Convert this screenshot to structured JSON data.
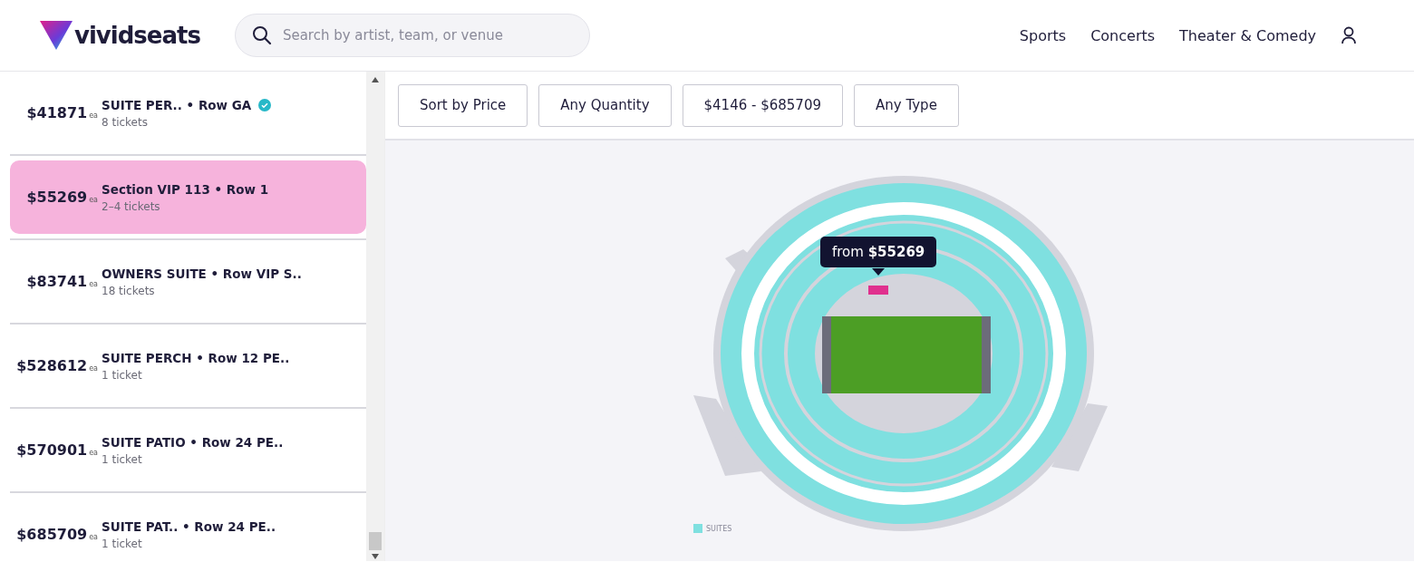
{
  "header": {
    "logo": "vividseats",
    "search": {
      "placeholder": "Search by artist, team, or venue"
    },
    "nav": [
      "Sports",
      "Concerts",
      "Theater & Comedy"
    ]
  },
  "listings": [
    {
      "price": "$41871",
      "unit": "ea",
      "title": "SUITE PER.. • Row GA",
      "tickets": "8 tickets",
      "verified": true,
      "selected": false
    },
    {
      "price": "$55269",
      "unit": "ea",
      "title": "Section VIP 113 • Row 1",
      "tickets": "2–4 tickets",
      "verified": false,
      "selected": true
    },
    {
      "price": "$83741",
      "unit": "ea",
      "title": "OWNERS SUITE • Row VIP S..",
      "tickets": "18 tickets",
      "verified": false,
      "selected": false
    },
    {
      "price": "$528612",
      "unit": "ea",
      "title": "SUITE PERCH • Row 12 PE..",
      "tickets": "1 ticket",
      "verified": false,
      "selected": false
    },
    {
      "price": "$570901",
      "unit": "ea",
      "title": "SUITE PATIO • Row 24 PE..",
      "tickets": "1 ticket",
      "verified": false,
      "selected": false
    },
    {
      "price": "$685709",
      "unit": "ea",
      "title": "SUITE PAT.. • Row 24 PE..",
      "tickets": "1 ticket",
      "verified": false,
      "selected": false
    }
  ],
  "filters": [
    "Sort by Price",
    "Any Quantity",
    "$4146 - $685709",
    "Any Type"
  ],
  "map": {
    "tooltip_prefix": "from",
    "tooltip_price": "$55269",
    "legend": [
      {
        "label": "SUITES",
        "color": "#7fe0e0"
      }
    ]
  }
}
